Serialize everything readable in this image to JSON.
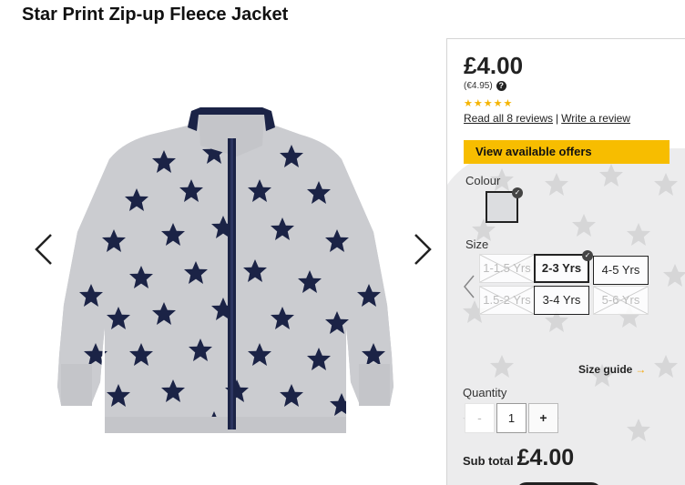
{
  "product": {
    "title": "Star Print Zip-up Fleece Jacket"
  },
  "pricing": {
    "price": "£4.00",
    "alt_price": "(€4.95)",
    "rating": 5,
    "stars": "★★★★★",
    "reviews_link": "Read all 8 reviews",
    "separator": "|",
    "write_review_link": "Write a review"
  },
  "offers": {
    "label": "View available offers",
    "color": "#f7bd00"
  },
  "colour": {
    "label": "Colour",
    "selected_swatch": "#dcdde0"
  },
  "size": {
    "label": "Size",
    "options": [
      {
        "label": "1-1.5 Yrs",
        "state": "unavailable"
      },
      {
        "label": "2-3 Yrs",
        "state": "selected"
      },
      {
        "label": "4-5 Yrs",
        "state": "available"
      },
      {
        "label": "1.5-2 Yrs",
        "state": "unavailable"
      },
      {
        "label": "3-4 Yrs",
        "state": "available"
      },
      {
        "label": "5-6 Yrs",
        "state": "unavailable"
      }
    ],
    "guide_label": "Size guide",
    "guide_chevron": "→"
  },
  "quantity": {
    "label": "Quantity",
    "value": "1",
    "minus": "-",
    "plus": "+"
  },
  "subtotal": {
    "label": "Sub total",
    "value": "£4.00"
  },
  "icons": {
    "prev": "chevron-left-icon",
    "next": "chevron-right-icon",
    "help": "?",
    "check": "✓"
  }
}
